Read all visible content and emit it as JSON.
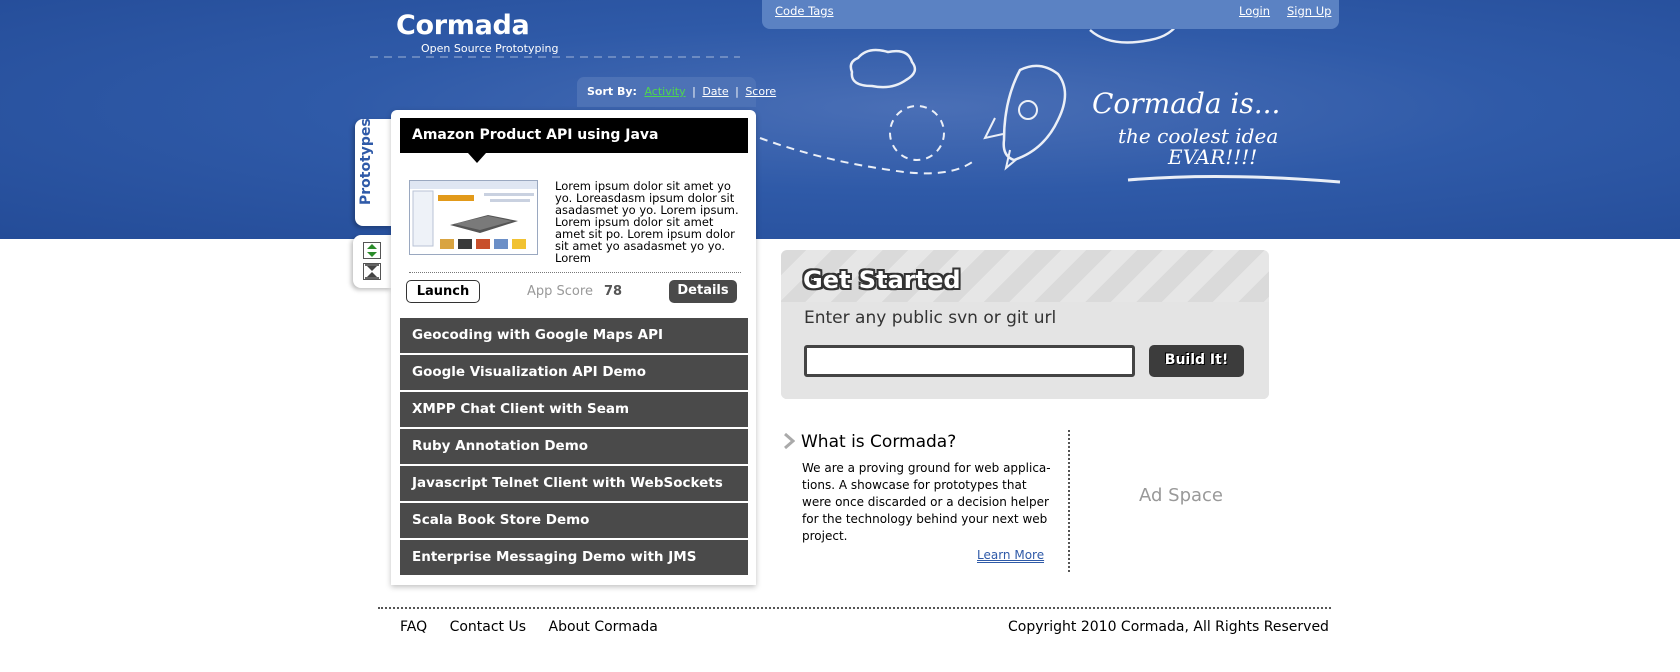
{
  "brand": {
    "name": "Cormada",
    "tagline": "Open Source Prototyping"
  },
  "topbar": {
    "code_tags": "Code Tags",
    "login": "Login",
    "signup": "Sign Up"
  },
  "hero_art": {
    "line1": "Cormada is...",
    "line2": "the coolest idea",
    "line3": "EVAR!!!!"
  },
  "sort": {
    "label": "Sort By:",
    "activity": "Activity",
    "date": "Date",
    "score": "Score",
    "separator": "|"
  },
  "sidebar": {
    "tab_label": "Prototypes",
    "icons": [
      "expand-icon",
      "collapse-icon"
    ]
  },
  "featured": {
    "title": "Amazon Product API using Java",
    "description": "Lorem ipsum dolor sit amet yo  yo. Loreasdasm ipsum dolor sit asadasmet yo  yo. Lorem ipsum. Lorem ipsum dolor sit amet amet sit po. Lorem ipsum dolor sit amet yo asadasmet yo  yo. Lorem",
    "launch_label": "Launch",
    "score_label": "App Score",
    "score_value": "78",
    "details_label": "Details"
  },
  "prototypes": [
    "Geocoding with Google Maps API",
    "Google Visualization API Demo",
    "XMPP Chat Client with Seam",
    "Ruby Annotation Demo",
    "Javascript Telnet Client with WebSockets",
    "Scala Book Store Demo",
    "Enterprise Messaging Demo with JMS"
  ],
  "get_started": {
    "title": "Get Started",
    "subtitle": "Enter any public svn or git url",
    "input_value": "",
    "button_label": "Build It!"
  },
  "what": {
    "title": "What is Cormada?",
    "text": "We are a proving ground for web applica- tions. A showcase for prototypes that were once discarded or a decision helper for the technology behind your next web project.",
    "learn_more": "Learn More"
  },
  "ad": {
    "label": "Ad Space"
  },
  "footer": {
    "links": [
      "FAQ",
      "Contact Us",
      "About Cormada"
    ],
    "copyright": "Copyright 2010 Cormada, All Rights Reserved"
  },
  "colors": {
    "hero_blue": "#2f5aa8",
    "active_sort": "#4fd64f",
    "dark_bar": "#4a4a4a"
  }
}
